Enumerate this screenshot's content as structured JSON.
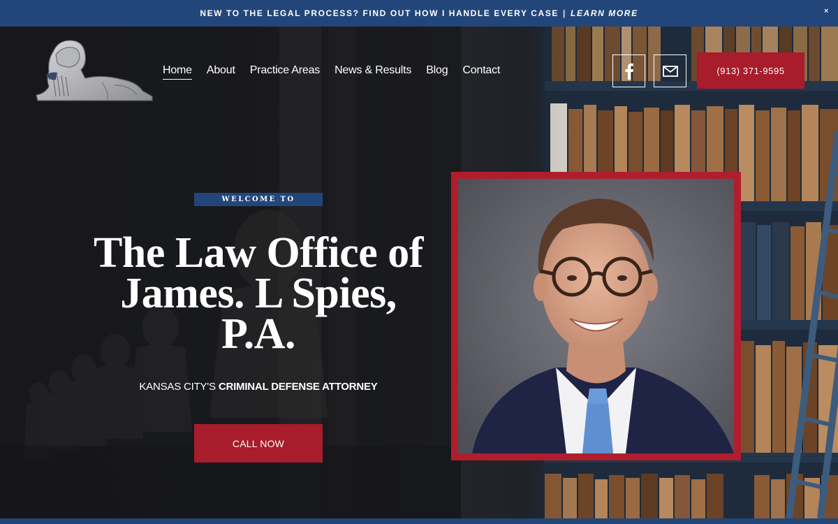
{
  "announcement": {
    "text": "NEW TO THE LEGAL PROCESS? FIND OUT HOW I HANDLE EVERY CASE",
    "separator": "|",
    "link": "LEARN MORE",
    "close": "×"
  },
  "nav": {
    "items": [
      "Home",
      "About",
      "Practice Areas",
      "News & Results",
      "Blog",
      "Contact"
    ],
    "active": "Home"
  },
  "header": {
    "phone": "(913) 371-9595",
    "social": [
      "facebook-icon",
      "mail-icon"
    ]
  },
  "hero": {
    "welcome": "WELCOME TO",
    "title_lines": [
      "The Law Office of",
      "James. L Spies,",
      "P.A."
    ],
    "subtitle_prefix": "KANSAS CITY'S ",
    "subtitle_bold": "CRIMINAL DEFENSE ATTORNEY",
    "cta": "CALL NOW"
  },
  "colors": {
    "brand_blue": "#23467a",
    "brand_red": "#a81c2b"
  }
}
